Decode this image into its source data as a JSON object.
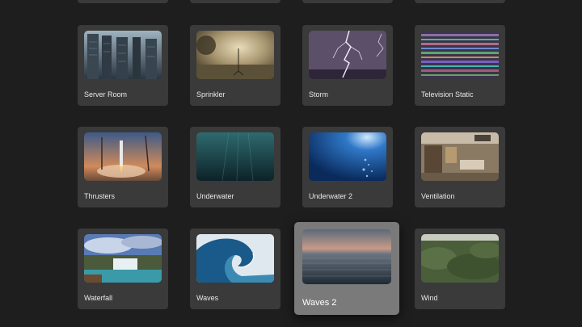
{
  "grid": {
    "items": [
      {
        "label": "Server Room",
        "thumb": "server-room"
      },
      {
        "label": "Sprinkler",
        "thumb": "sprinkler"
      },
      {
        "label": "Storm",
        "thumb": "storm"
      },
      {
        "label": "Television Static",
        "thumb": "television-static"
      },
      {
        "label": "Thrusters",
        "thumb": "thrusters"
      },
      {
        "label": "Underwater",
        "thumb": "underwater"
      },
      {
        "label": "Underwater 2",
        "thumb": "underwater-2"
      },
      {
        "label": "Ventilation",
        "thumb": "ventilation"
      },
      {
        "label": "Waterfall",
        "thumb": "waterfall"
      },
      {
        "label": "Waves",
        "thumb": "waves"
      },
      {
        "label": "Waves 2",
        "thumb": "waves-2",
        "focused": true
      },
      {
        "label": "Wind",
        "thumb": "wind"
      }
    ]
  }
}
